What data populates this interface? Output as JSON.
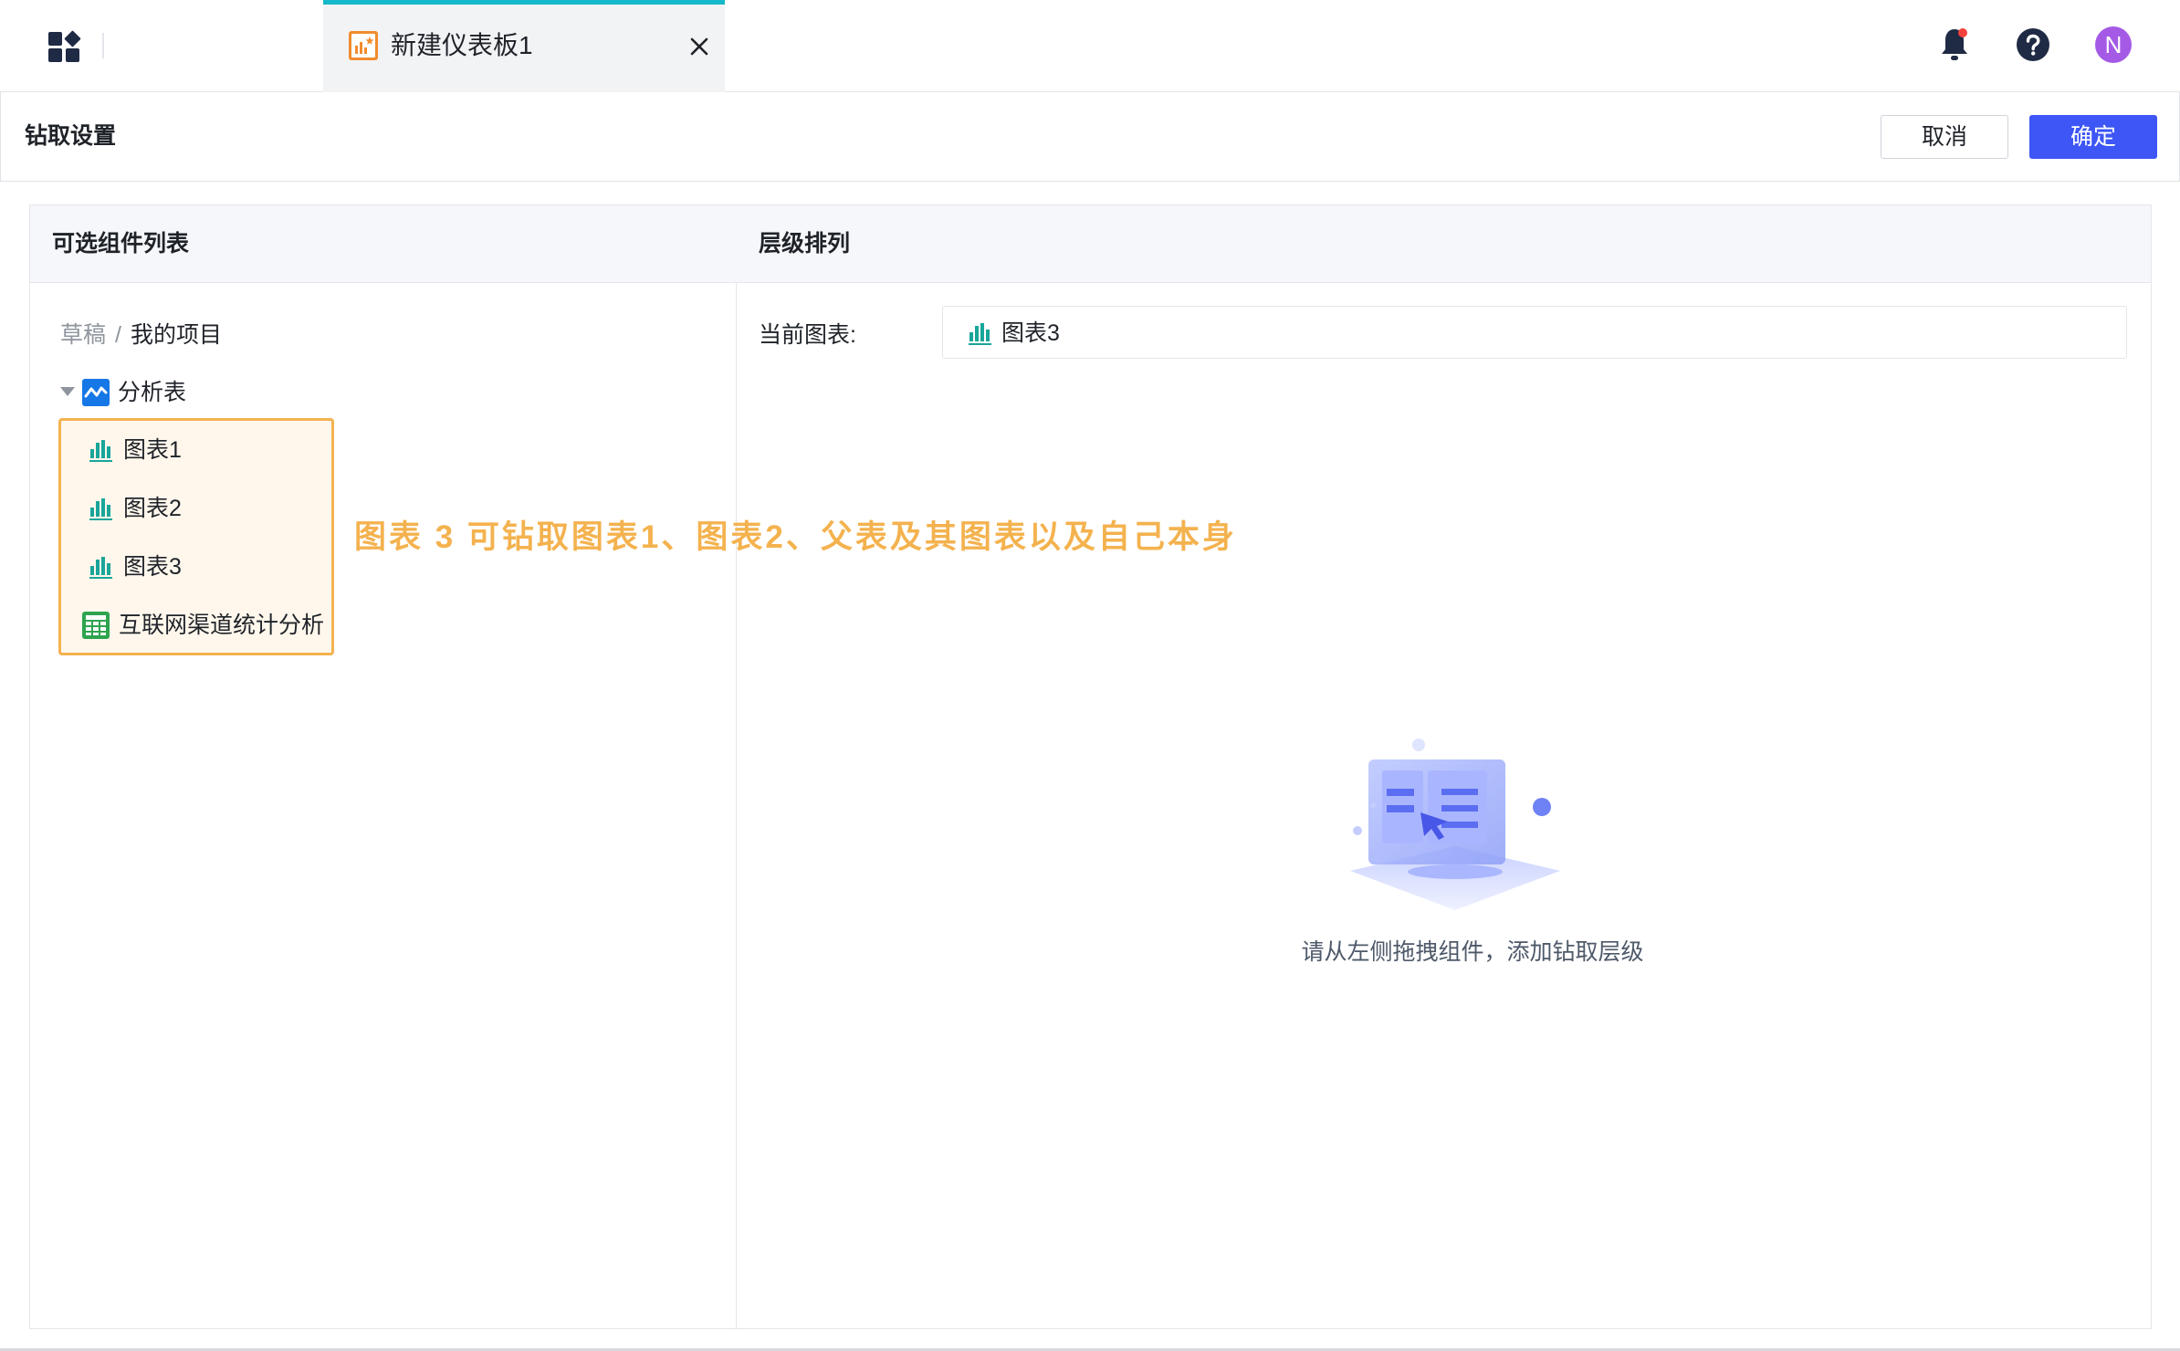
{
  "topbar": {
    "tab_label": "新建仪表板1",
    "avatar_letter": "N"
  },
  "header": {
    "title": "钻取设置",
    "cancel_label": "取消",
    "confirm_label": "确定"
  },
  "left_panel": {
    "title": "可选组件列表",
    "breadcrumb": {
      "root": "草稿",
      "separator": "/",
      "current": "我的项目"
    },
    "tree": {
      "parent_label": "分析表",
      "items": [
        {
          "label": "图表1",
          "icon": "bar-chart-icon"
        },
        {
          "label": "图表2",
          "icon": "bar-chart-icon"
        },
        {
          "label": "图表3",
          "icon": "bar-chart-icon"
        },
        {
          "label": "互联网渠道统计分析",
          "icon": "table-icon"
        }
      ]
    }
  },
  "annotation": "图表 3 可钻取图表1、图表2、父表及其图表以及自己本身",
  "right_panel": {
    "title": "层级排列",
    "current_chart_label": "当前图表:",
    "current_chart_value": "图表3",
    "empty_text": "请从左侧拖拽组件，添加钻取层级"
  },
  "colors": {
    "accent_blue": "#3d56f5",
    "tab_top_border": "#14b8c8",
    "highlight_orange": "#f4b24e",
    "chart_icon_teal": "#1aa59a",
    "table_icon_green": "#2ea44f",
    "avatar_purple": "#a55ae6"
  }
}
